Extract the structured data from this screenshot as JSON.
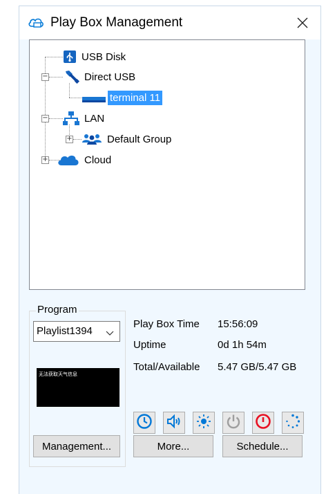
{
  "window": {
    "title": "Play Box Management"
  },
  "icons": {
    "title": "cloud-box-icon",
    "close": "close-icon"
  },
  "tree": {
    "usb_disk": {
      "label": "USB Disk",
      "icon": "usb-icon"
    },
    "direct_usb": {
      "label": "Direct USB",
      "icon": "usb-cable-icon",
      "expanded": true
    },
    "terminal": {
      "label": "terminal 11",
      "icon": "terminal-device-icon",
      "selected": true
    },
    "lan": {
      "label": "LAN",
      "icon": "network-icon",
      "expanded": true
    },
    "default_group": {
      "label": "Default Group",
      "icon": "group-icon",
      "expanded": false
    },
    "cloud": {
      "label": "Cloud",
      "icon": "cloud-icon",
      "expanded": false
    }
  },
  "program": {
    "group_label": "Program",
    "selected": "Playlist1394",
    "preview_text": "无法获取天气信息"
  },
  "status": {
    "play_box_time_label": "Play Box Time",
    "play_box_time_value": "15:56:09",
    "uptime_label": "Uptime",
    "uptime_value": "0d 1h 54m",
    "storage_label": "Total/Available",
    "storage_value": "5.47 GB/5.47 GB"
  },
  "actions": {
    "icons": [
      "clock-icon",
      "volume-icon",
      "brightness-icon",
      "power-icon",
      "power-off-icon",
      "loading-icon"
    ],
    "management_label": "Management...",
    "more_label": "More...",
    "schedule_label": "Schedule..."
  },
  "colors": {
    "accent": "#0078d7",
    "selection": "#3399ff",
    "danger": "#e81123"
  }
}
